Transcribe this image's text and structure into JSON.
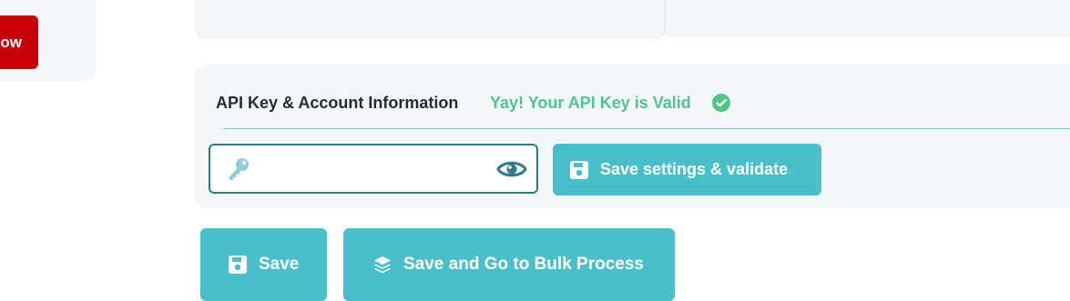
{
  "left_panel": {
    "action_label": "ow"
  },
  "api_section": {
    "title": "API Key & Account Information",
    "status_text": "Yay! Your API Key is Valid",
    "input": {
      "value": "",
      "placeholder": ""
    },
    "validate_button_label": "Save settings & validate"
  },
  "footer": {
    "save_label": "Save",
    "bulk_label": "Save and Go to Bulk Process"
  },
  "colors": {
    "accent": "#48bfca",
    "success": "#52c48a",
    "danger": "#c8000a",
    "panel_bg": "#f4f8fb"
  }
}
